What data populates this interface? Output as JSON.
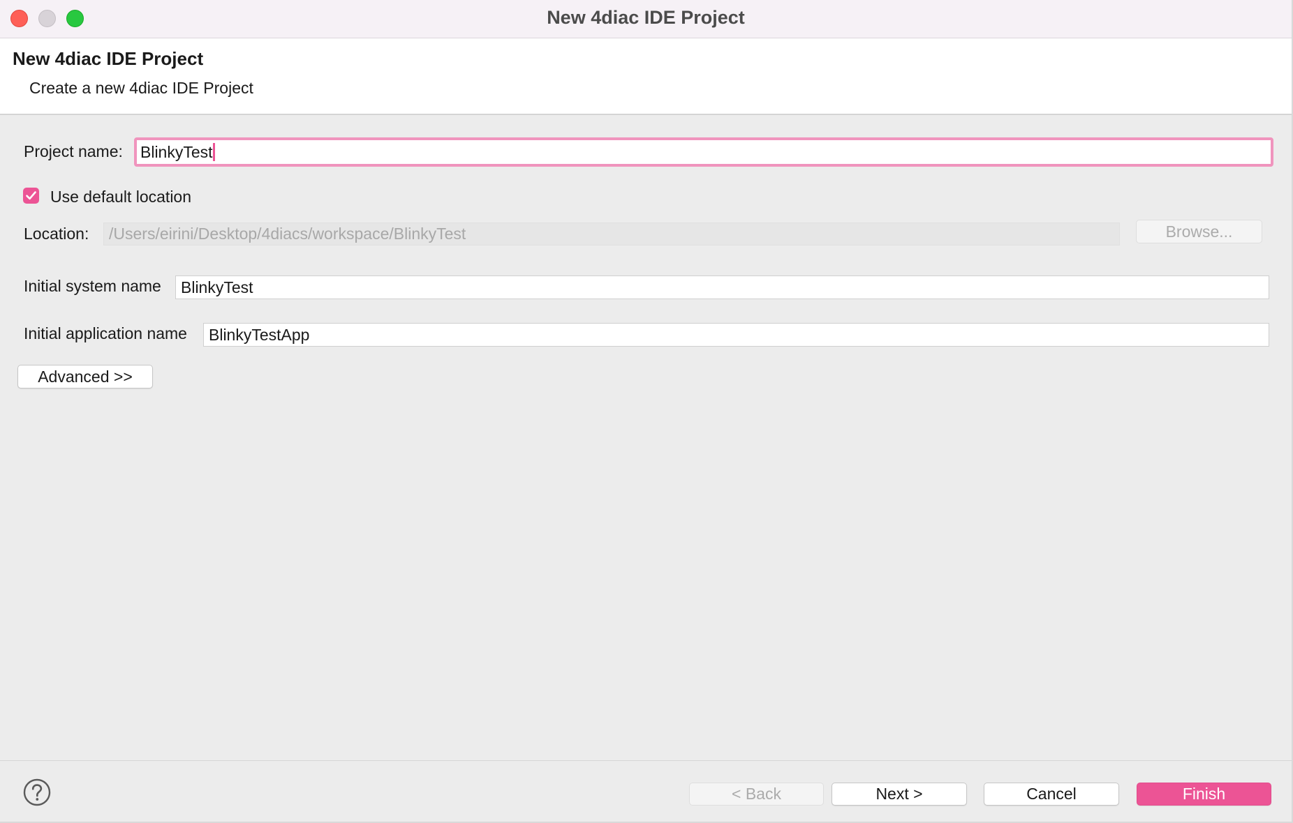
{
  "window": {
    "title": "New 4diac IDE Project"
  },
  "banner": {
    "title": "New 4diac IDE Project",
    "description": "Create a new 4diac IDE Project"
  },
  "form": {
    "project_name_label": "Project name:",
    "project_name_value": "BlinkyTest",
    "use_default_location_label": "Use default location",
    "use_default_location_checked": true,
    "location_label": "Location:",
    "location_value": "/Users/eirini/Desktop/4diacs/workspace/BlinkyTest",
    "browse_label": "Browse...",
    "system_name_label": "Initial system name",
    "system_name_value": "BlinkyTest",
    "application_name_label": "Initial application name",
    "application_name_value": "BlinkyTestApp",
    "advanced_label": "Advanced >>"
  },
  "footer": {
    "help_icon": "question-circle-icon",
    "back_label": "< Back",
    "next_label": "Next >",
    "cancel_label": "Cancel",
    "finish_label": "Finish"
  },
  "colors": {
    "accent": "#ec5495",
    "focus_ring": "#f094bd",
    "close": "#fe5f57",
    "maximize": "#28c840"
  }
}
